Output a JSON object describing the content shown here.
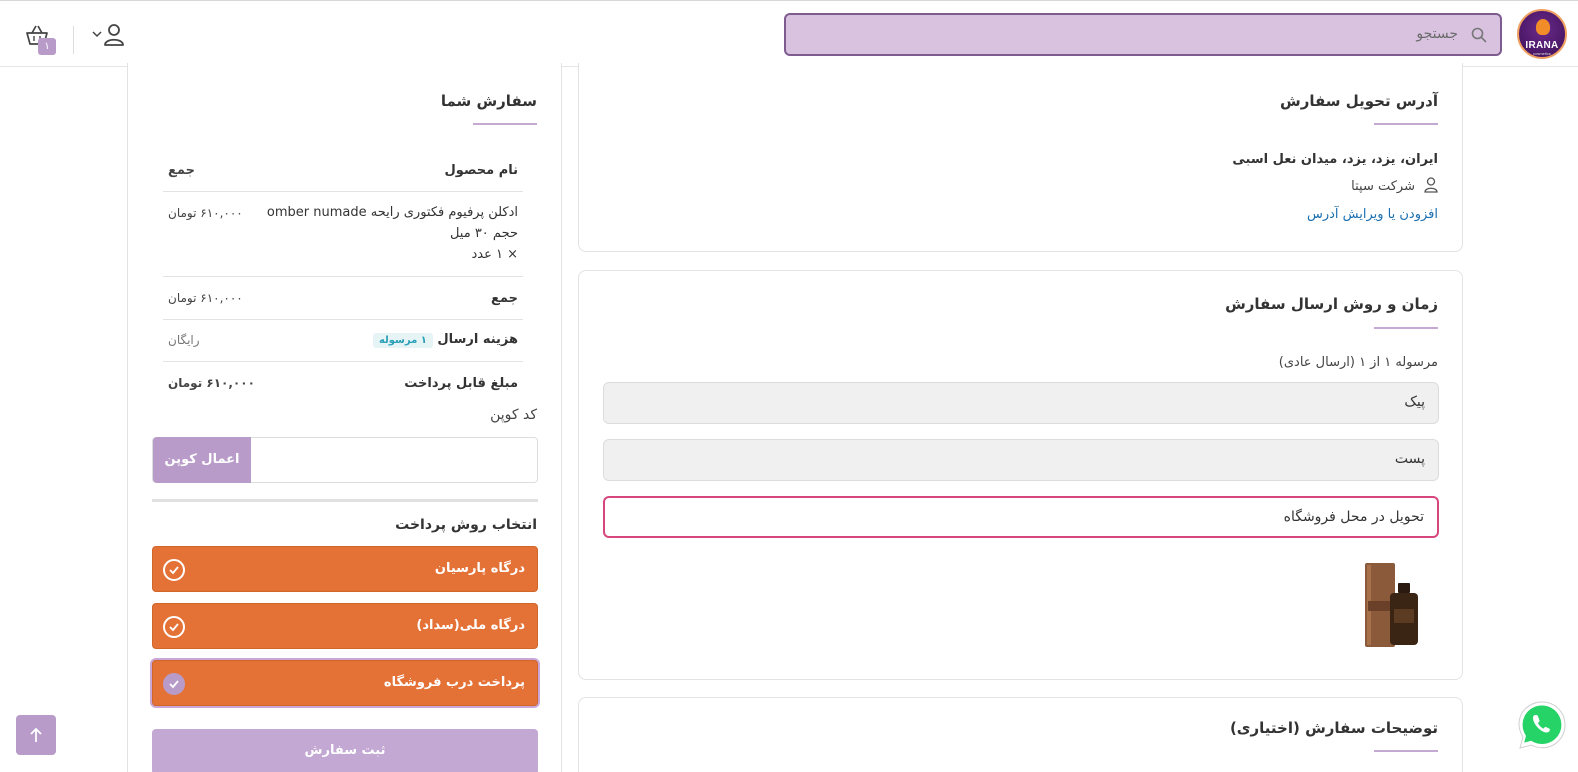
{
  "header": {
    "logo_text": "IRANA",
    "logo_subtext": "cosmetics",
    "search_placeholder": "جستجو",
    "cart_count": "۱"
  },
  "address": {
    "title": "آدرس تحویل سفارش",
    "line": "ایران، یزد، یزد، میدان نعل اسبی",
    "company": "شرکت سپتا",
    "edit_link": "افزودن یا ویرایش آدرس"
  },
  "shipping": {
    "title": "زمان و روش ارسال سفارش",
    "package_label": "مرسوله ۱ از ۱ (ارسال عادی)",
    "options": [
      "پیک",
      "پست",
      "تحویل در محل فروشگاه"
    ],
    "selected_index": 2
  },
  "notes": {
    "title": "توضیحات سفارش (اختیاری)"
  },
  "order": {
    "title": "سفارش شما",
    "col_product": "نام محصول",
    "col_total": "جمع",
    "item_name_1": "ادکلن پرفیوم فکتوری رایحه omber numade",
    "item_name_2": "حجم ۳۰ میل",
    "item_qty": "× ۱ عدد",
    "item_price": "۶۱۰,۰۰۰ تومان",
    "subtotal_label": "جمع",
    "subtotal_value": "۶۱۰,۰۰۰ تومان",
    "shipping_label": "هزینه ارسال",
    "shipping_badge": "۱ مرسوله",
    "shipping_value": "رایگان",
    "payable_label": "مبلغ قابل پرداخت",
    "payable_value": "۶۱۰,۰۰۰ تومان",
    "coupon_label": "کد کوپن",
    "coupon_button": "اعمال کوپن",
    "payment_title": "انتخاب روش پرداخت",
    "payment_methods": [
      "درگاه پارسیان",
      "درگاه ملی(سداد)",
      "پرداخت درب فروشگاه"
    ],
    "payment_selected_index": 2,
    "submit": "ثبت سفارش"
  },
  "colors": {
    "brand_purple": "#b89bc8",
    "payment_orange": "#e47237",
    "selected_border": "#d8467e",
    "link_blue": "#1a6fb0"
  }
}
